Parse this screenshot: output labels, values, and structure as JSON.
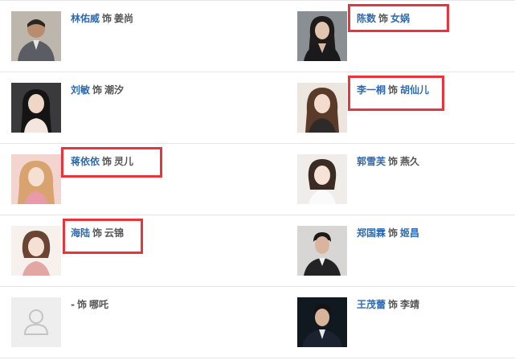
{
  "cast": [
    {
      "left": {
        "actor": "林佑威",
        "as_word": "饰",
        "role": "姜尚",
        "role_linked": false,
        "highlighted": false,
        "photo": "actor-photo"
      },
      "right": {
        "actor": "陈数",
        "as_word": "饰",
        "role": "女娲",
        "role_linked": true,
        "highlighted": true,
        "photo": "actor-photo"
      }
    },
    {
      "left": {
        "actor": "刘敏",
        "as_word": "饰",
        "role": "潮汐",
        "role_linked": false,
        "highlighted": false,
        "photo": "actor-photo"
      },
      "right": {
        "actor": "李一桐",
        "as_word": "饰",
        "role": "胡仙儿",
        "role_linked": true,
        "highlighted": true,
        "photo": "actor-photo"
      }
    },
    {
      "left": {
        "actor": "蒋依依",
        "as_word": "饰",
        "role": "灵儿",
        "role_linked": false,
        "highlighted": true,
        "photo": "actor-photo"
      },
      "right": {
        "actor": "郭雪芙",
        "as_word": "饰",
        "role": "燕久",
        "role_linked": false,
        "highlighted": false,
        "photo": "actor-photo"
      }
    },
    {
      "left": {
        "actor": "海陆",
        "as_word": "饰",
        "role": "云锦",
        "role_linked": false,
        "highlighted": true,
        "photo": "actor-photo"
      },
      "right": {
        "actor": "郑国霖",
        "as_word": "饰",
        "role": "姬昌",
        "role_linked": true,
        "highlighted": false,
        "photo": "actor-photo"
      }
    },
    {
      "left": {
        "actor": "-",
        "as_word": "饰",
        "role": "哪吒",
        "role_linked": false,
        "highlighted": false,
        "photo": "placeholder-avatar"
      },
      "right": {
        "actor": "王茂蕾",
        "as_word": "饰",
        "role": "李靖",
        "role_linked": false,
        "highlighted": false,
        "photo": "actor-photo"
      }
    }
  ],
  "colors": {
    "link": "#2d6ab4",
    "text": "#555555",
    "highlight": "#e8343a",
    "divider": "#e6e6e6"
  }
}
